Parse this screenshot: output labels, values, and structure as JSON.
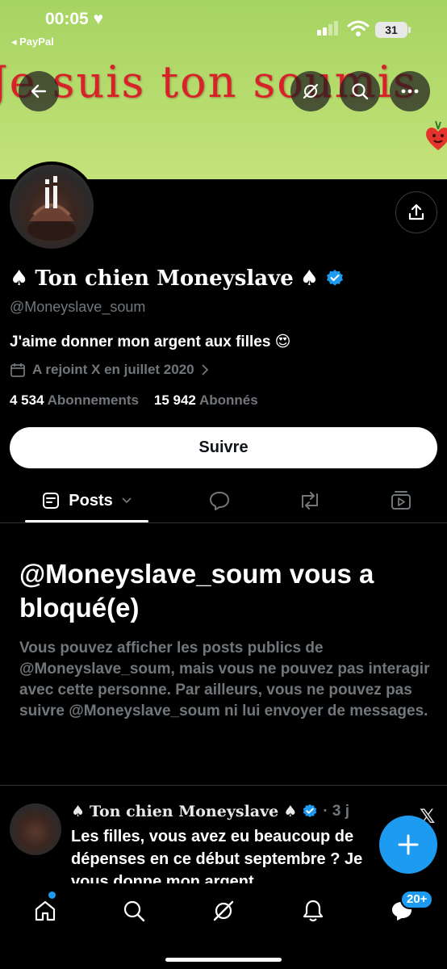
{
  "status_bar": {
    "time": "00:05",
    "heart": "♥",
    "back_app": "◂ PayPal",
    "battery": "31"
  },
  "banner": {
    "text": "Je suis ton soumis"
  },
  "profile": {
    "name": "Ton chien Moneyslave",
    "spade": "♠",
    "handle": "@Moneyslave_soum",
    "bio": "J'aime donner mon argent aux filles 😍",
    "joined": "A rejoint X en juillet 2020",
    "following_count": "4 534",
    "following_label": "Abonnements",
    "followers_count": "15 942",
    "followers_label": "Abonnés"
  },
  "follow_button": "Suivre",
  "tabs": {
    "posts_label": "Posts"
  },
  "blocked": {
    "title": "@Moneyslave_soum vous a bloqué(e)",
    "description": "Vous pouvez afficher les posts publics de @Moneyslave_soum, mais vous ne pouvez pas interagir avec cette personne. Par ailleurs, vous ne pouvez pas suivre @Moneyslave_soum ni lui envoyer de messages."
  },
  "post": {
    "author": "Ton chien Moneyslave",
    "spade": "♠",
    "time": "· 3 j",
    "text": "Les filles, vous avez eu beaucoup de dépenses en ce début septembre ? Je vous donne mon argent"
  },
  "nav": {
    "messages_badge": "20+"
  },
  "colors": {
    "accent": "#1d9bf0",
    "banner_green": "#b8dc6f",
    "banner_text_red": "#d8222a"
  }
}
